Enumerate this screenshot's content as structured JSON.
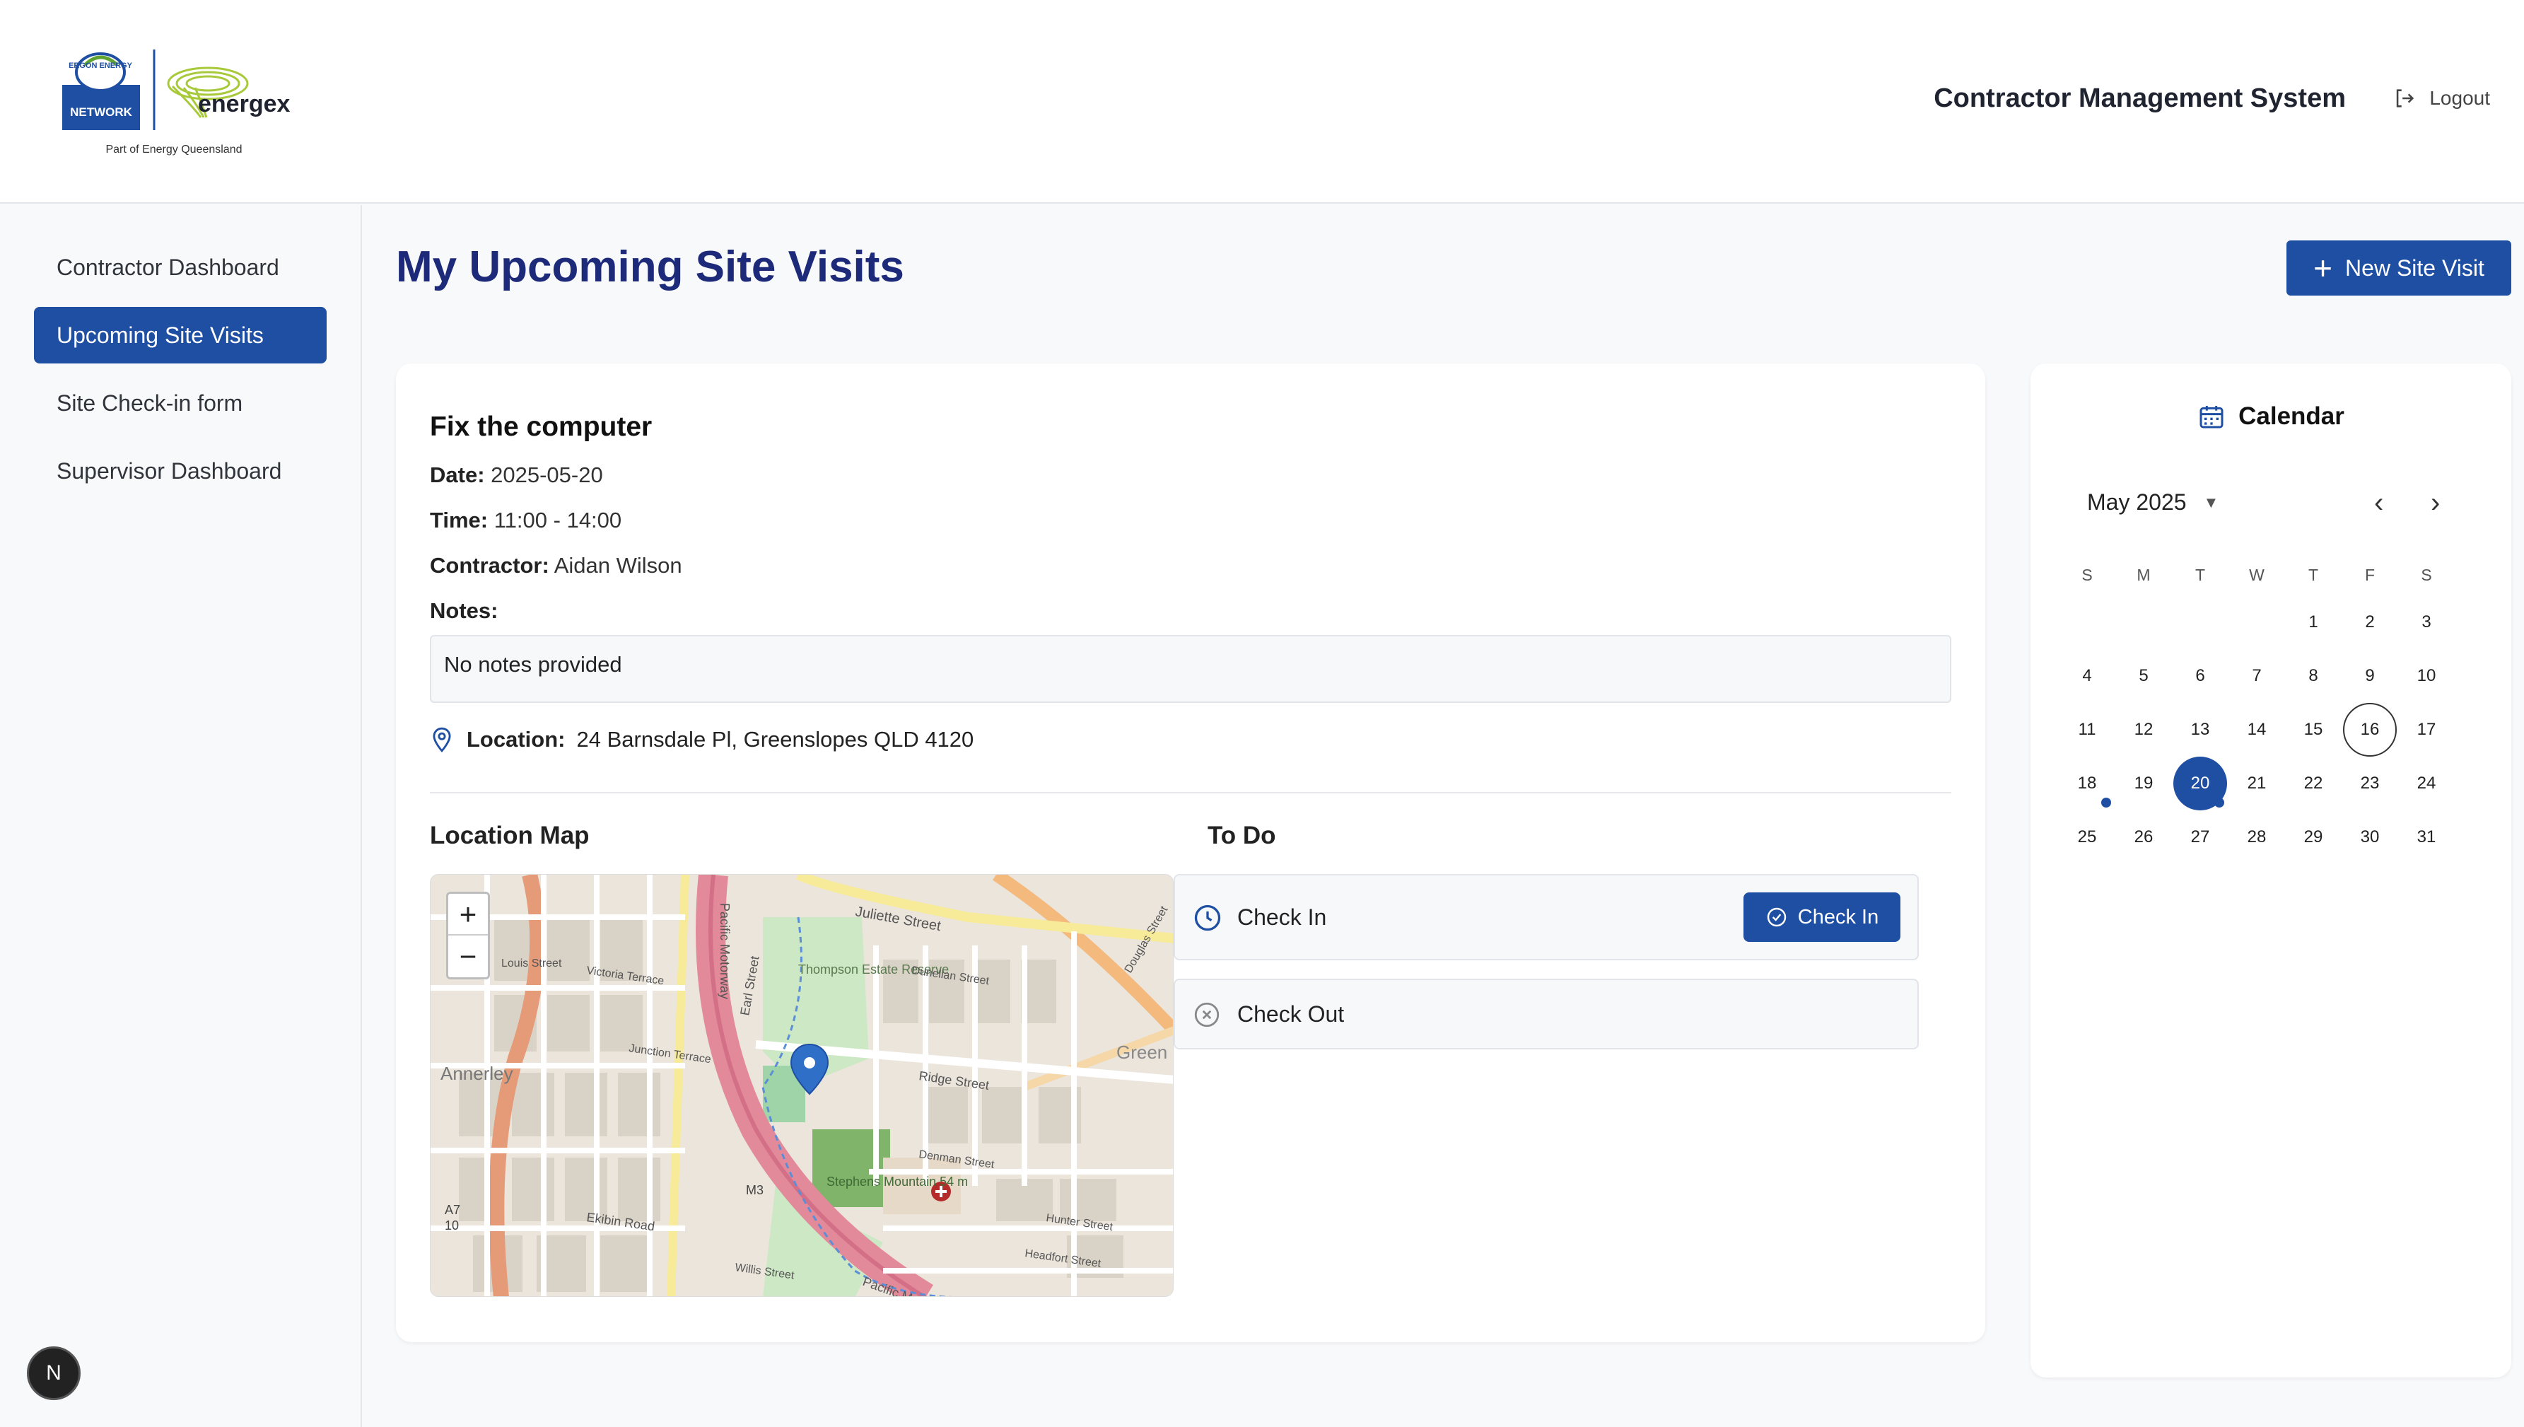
{
  "header": {
    "logo_top_line": "ERGON ENERGY",
    "logo_network": "NETWORK",
    "logo_energex": "energex",
    "logo_tagline": "Part of Energy Queensland",
    "system_title": "Contractor Management System",
    "logout_label": "Logout"
  },
  "sidebar": {
    "items": [
      {
        "label": "Contractor Dashboard",
        "active": false
      },
      {
        "label": "Upcoming Site Visits",
        "active": true
      },
      {
        "label": "Site Check-in form",
        "active": false
      },
      {
        "label": "Supervisor Dashboard",
        "active": false
      }
    ],
    "badge": "N"
  },
  "main": {
    "page_title": "My Upcoming Site Visits",
    "new_button_label": "New Site Visit"
  },
  "visit": {
    "title": "Fix the computer",
    "date_label": "Date:",
    "date": "2025-05-20",
    "time_label": "Time:",
    "time": "11:00 - 14:00",
    "contractor_label": "Contractor:",
    "contractor": "Aidan Wilson",
    "notes_label": "Notes:",
    "notes": "No notes provided",
    "location_label": "Location:",
    "location": "24 Barnsdale Pl, Greenslopes QLD 4120"
  },
  "map": {
    "section_title": "Location Map",
    "zoom_in": "+",
    "zoom_out": "−",
    "labels": {
      "juliette": "Juliette Street",
      "thompson": "Thompson Estate Reserve",
      "annerley": "Annerley",
      "pacific": "Pacific Motorway",
      "ridge": "Ridge Street",
      "dunellan": "Dunellan Street",
      "victoria": "Victoria Terrace",
      "junction": "Junction Terrace",
      "louis": "Louis Street",
      "ekibin": "Ekibin Road",
      "m3": "M3",
      "stephens": "Stephens Mountain 54 m",
      "green": "Green",
      "denman": "Denman Street",
      "hunter": "Hunter Street",
      "headfort": "Headfort Street",
      "willis": "Willis Street",
      "a7": "A7",
      "ten": "10",
      "earl": "Earl Street",
      "douglas": "Douglas Street",
      "pacific_m": "Pacific M"
    }
  },
  "todo": {
    "section_title": "To Do",
    "items": [
      {
        "label": "Check In",
        "button": "Check In"
      },
      {
        "label": "Check Out"
      }
    ]
  },
  "calendar": {
    "title": "Calendar",
    "month": "May 2025",
    "weekdays": [
      "S",
      "M",
      "T",
      "W",
      "T",
      "F",
      "S"
    ],
    "first_weekday_index": 4,
    "days_in_month": 31,
    "today": 16,
    "selected": 20,
    "event_days": [
      18,
      20
    ],
    "accent_color": "#1f4fa3"
  }
}
